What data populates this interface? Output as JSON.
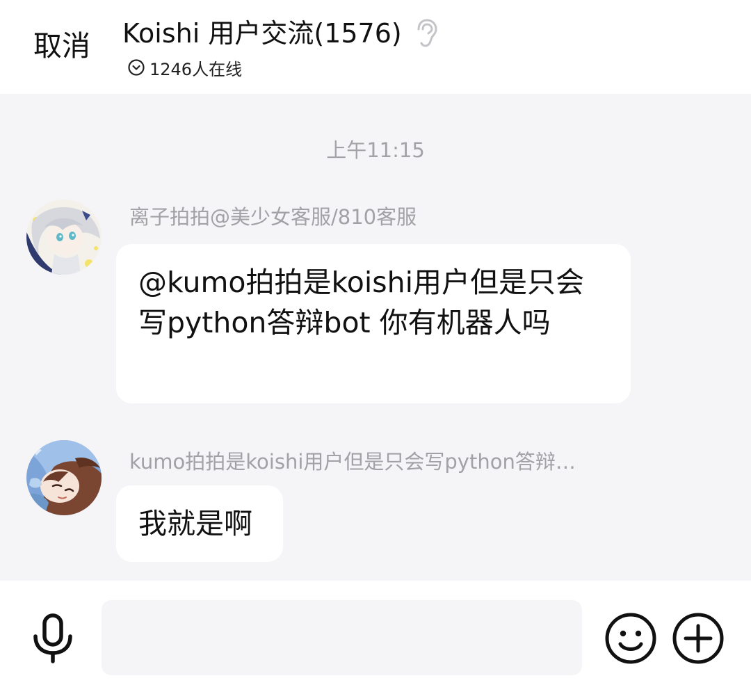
{
  "header": {
    "cancel_label": "取消",
    "group_title": "Koishi 用户交流(1576)",
    "online_text": "1246人在线"
  },
  "chat": {
    "timestamp": "上午11:15",
    "messages": [
      {
        "sender": "离子拍拍@美少女客服/810客服",
        "text": "@kumo拍拍是koishi用户但是只会写python答辩bot 你有机器人吗",
        "avatar": "anime-avatar-silver-hair"
      },
      {
        "sender": "kumo拍拍是koishi用户但是只会写python答辩…",
        "text": "我就是啊",
        "avatar": "anime-avatar-brown-hair"
      }
    ]
  },
  "input_bar": {
    "placeholder": "",
    "value": "",
    "icons": [
      "microphone-icon",
      "emoji-icon",
      "plus-icon"
    ]
  },
  "colors": {
    "background": "#f5f4f6",
    "header_bg": "#ffffff",
    "bubble_bg": "#ffffff",
    "muted_text": "#a2a2a6"
  }
}
